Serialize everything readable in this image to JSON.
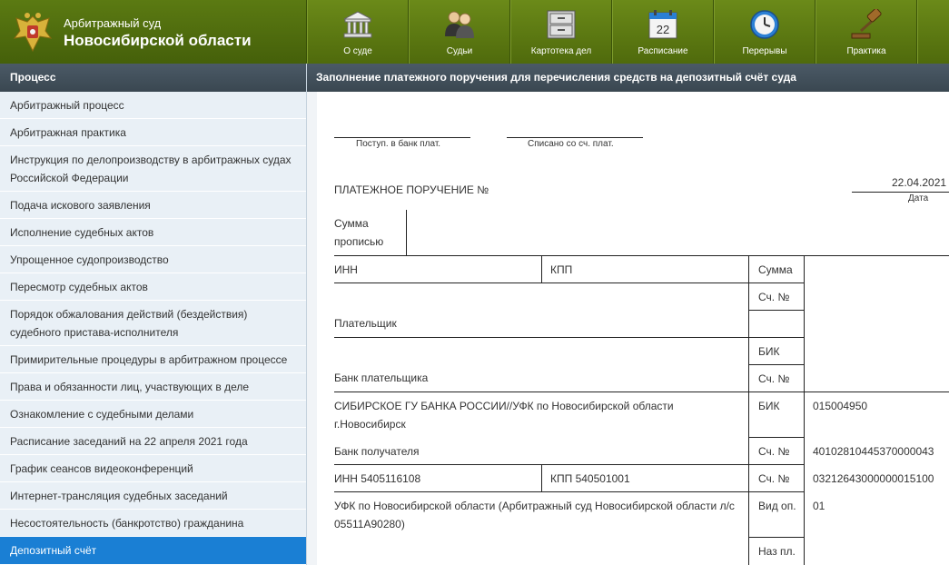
{
  "header": {
    "court_line1": "Арбитражный суд",
    "court_line2": "Новосибирской области",
    "nav": [
      {
        "label": "О суде",
        "icon": "building-icon"
      },
      {
        "label": "Судьи",
        "icon": "judges-icon"
      },
      {
        "label": "Картотека дел",
        "icon": "file-cabinet-icon"
      },
      {
        "label": "Расписание",
        "icon": "calendar-icon",
        "calendar_day": "22"
      },
      {
        "label": "Перерывы",
        "icon": "clock-icon"
      },
      {
        "label": "Практика",
        "icon": "gavel-icon"
      }
    ]
  },
  "sidebar": {
    "title": "Процесс",
    "items": [
      {
        "label": "Арбитражный процесс"
      },
      {
        "label": "Арбитражная практика"
      },
      {
        "label": "Инструкция по делопроизводству в арбитражных судах Российской Федерации"
      },
      {
        "label": "Подача искового заявления"
      },
      {
        "label": "Исполнение судебных актов"
      },
      {
        "label": "Упрощенное судопроизводство"
      },
      {
        "label": "Пересмотр судебных актов"
      },
      {
        "label": "Порядок обжалования действий (бездействия) судебного пристава-исполнителя"
      },
      {
        "label": "Примирительные процедуры в арбитражном процессе"
      },
      {
        "label": "Права и обязанности лиц, участвующих в деле"
      },
      {
        "label": "Ознакомление с судебными делами"
      },
      {
        "label": "Расписание заседаний на 22 апреля 2021 года"
      },
      {
        "label": "График сеансов видеоконференций"
      },
      {
        "label": "Интернет-трансляция судебных заседаний"
      },
      {
        "label": "Несостоятельность (банкротство) гражданина"
      },
      {
        "label": "Депозитный счёт",
        "active": true
      }
    ]
  },
  "main": {
    "title": "Заполнение платежного поручения для перечисления средств на депозитный счёт суда"
  },
  "form": {
    "received_label": "Поступ. в банк плат.",
    "debited_label": "Списано со сч. плат.",
    "order_title": "ПЛАТЕЖНОЕ ПОРУЧЕНИЕ №",
    "date_value": "22.04.2021",
    "date_label": "Дата",
    "sum_words_line1": "Сумма",
    "sum_words_line2": "прописью",
    "inn_label": "ИНН",
    "kpp_label": "КПП",
    "sum_label": "Сумма",
    "account_label": "Сч. №",
    "payer_label": "Плательщик",
    "bik_label": "БИК",
    "payer_bank_label": "Банк плательщика",
    "recipient_bank_line1": "СИБИРСКОЕ ГУ БАНКА РОССИИ//УФК по Новосибирской области",
    "recipient_bank_line2": "г.Новосибирск",
    "recipient_bik": "015004950",
    "recipient_bank_label": "Банк получателя",
    "recipient_corr_account": "40102810445370000043",
    "recipient_inn": "ИНН  5405116108",
    "recipient_kpp": "КПП  540501001",
    "recipient_account": "03212643000000015100",
    "recipient_line1": "УФК по Новосибирской области (Арбитражный суд Новосибирской области л/с",
    "recipient_line2": "05511А90280)",
    "op_type_label": "Вид оп.",
    "op_type_value": "01",
    "payment_purpose_label": "Наз пл."
  },
  "colors": {
    "header_green": "#5b7a12",
    "sidebar_bg": "#e9f0f6",
    "section_head": "#3f4c57",
    "active_item": "#1a7fd4"
  }
}
